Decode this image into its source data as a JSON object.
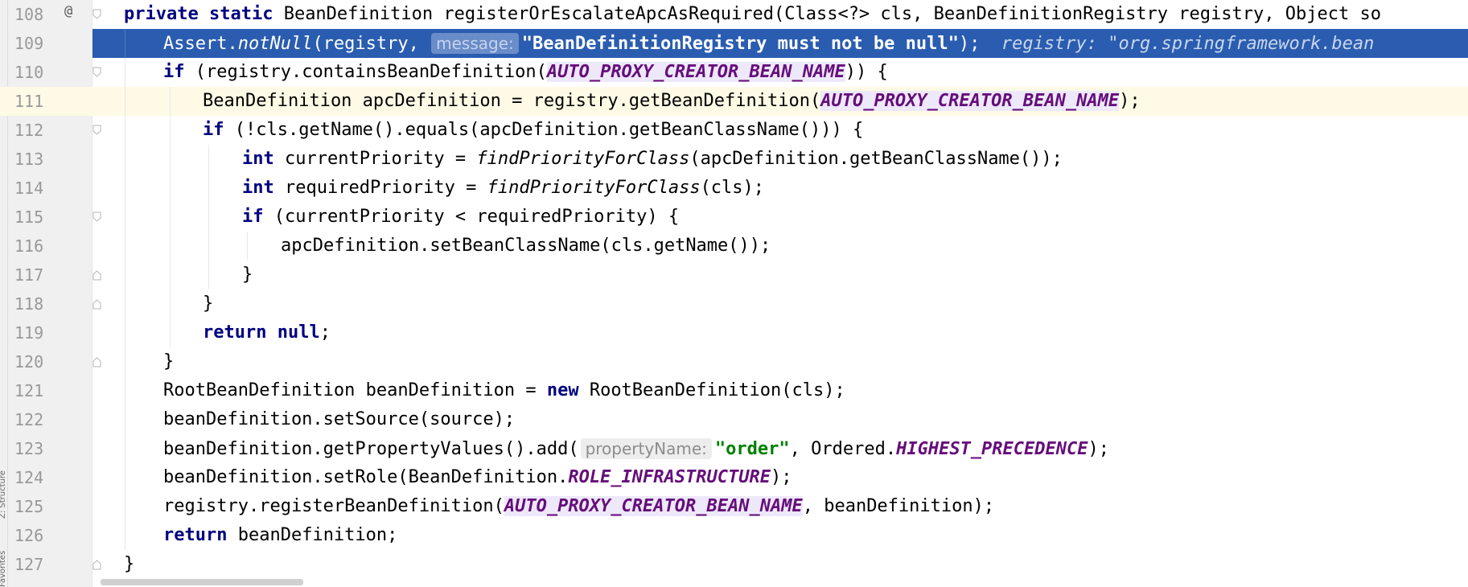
{
  "tool_window": {
    "structure_label": "Z: Structure",
    "favorites_label": "Favorites"
  },
  "lines": [
    {
      "number": "108",
      "marker": "@",
      "fold": "down"
    },
    {
      "number": "109",
      "fold": "none"
    },
    {
      "number": "110",
      "fold": "down"
    },
    {
      "number": "111",
      "fold": "none"
    },
    {
      "number": "112",
      "fold": "down"
    },
    {
      "number": "113",
      "fold": "none"
    },
    {
      "number": "114",
      "fold": "none"
    },
    {
      "number": "115",
      "fold": "down"
    },
    {
      "number": "116",
      "fold": "none"
    },
    {
      "number": "117",
      "fold": "up"
    },
    {
      "number": "118",
      "fold": "up"
    },
    {
      "number": "119",
      "fold": "none"
    },
    {
      "number": "120",
      "fold": "up"
    },
    {
      "number": "121",
      "fold": "none"
    },
    {
      "number": "122",
      "fold": "none"
    },
    {
      "number": "123",
      "fold": "none"
    },
    {
      "number": "124",
      "fold": "none"
    },
    {
      "number": "125",
      "fold": "none"
    },
    {
      "number": "126",
      "fold": "none"
    },
    {
      "number": "127",
      "fold": "up"
    }
  ],
  "code": {
    "l108": {
      "kw1": "private",
      "kw2": "static",
      "rest": " BeanDefinition registerOrEscalateApcAsRequired(Class<?> cls, BeanDefinitionRegistry registry, Object so"
    },
    "l109": {
      "a": "Assert.",
      "m": "notNull",
      "b": "(registry, ",
      "hint": "message:",
      "str": "\"BeanDefinitionRegistry must not be null\"",
      "c": ");",
      "inline_value": "registry: \"org.springframework.bean"
    },
    "l110": {
      "kw": "if",
      "a": " (registry.containsBeanDefinition(",
      "const": "AUTO_PROXY_CREATOR_BEAN_NAME",
      "b": ")) {"
    },
    "l111": {
      "a": "BeanDefinition apcDefinition = registry.getBeanDefinition(",
      "const": "AUTO_PROXY_CREATOR_BEAN_NAME",
      "b": ");"
    },
    "l112": {
      "kw": "if",
      "a": " (!cls.getName().equals(apcDefinition.getBeanClassName())) {"
    },
    "l113": {
      "kw": "int",
      "a": " currentPriority = ",
      "m": "findPriorityForClass",
      "b": "(apcDefinition.getBeanClassName());"
    },
    "l114": {
      "kw": "int",
      "a": " requiredPriority = ",
      "m": "findPriorityForClass",
      "b": "(cls);"
    },
    "l115": {
      "kw": "if",
      "a": " (currentPriority < requiredPriority) {"
    },
    "l116": {
      "a": "apcDefinition.setBeanClassName(cls.getName());"
    },
    "l117": {
      "a": "}"
    },
    "l118": {
      "a": "}"
    },
    "l119": {
      "kw": "return",
      "kw2": "null",
      "b": ";"
    },
    "l120": {
      "a": "}"
    },
    "l121": {
      "a": "RootBeanDefinition beanDefinition = ",
      "kw": "new",
      "b": " RootBeanDefinition(cls);"
    },
    "l122": {
      "a": "beanDefinition.setSource(source);"
    },
    "l123": {
      "a": "beanDefinition.getPropertyValues().add(",
      "hint": "propertyName:",
      "str": "\"order\"",
      "b": ", Ordered.",
      "const": "HIGHEST_PRECEDENCE",
      "c": ");"
    },
    "l124": {
      "a": "beanDefinition.setRole(BeanDefinition.",
      "const": "ROLE_INFRASTRUCTURE",
      "b": ");"
    },
    "l125": {
      "a": "registry.registerBeanDefinition(",
      "const": "AUTO_PROXY_CREATOR_BEAN_NAME",
      "b": ", beanDefinition);"
    },
    "l126": {
      "kw": "return",
      "a": " beanDefinition;"
    },
    "l127": {
      "a": "}"
    }
  },
  "colors": {
    "keyword": "#000080",
    "constant": "#660e7a",
    "string": "#008000",
    "selection": "#2a5db0",
    "current_line": "#fefae6",
    "gutter": "#f0f0f0"
  }
}
